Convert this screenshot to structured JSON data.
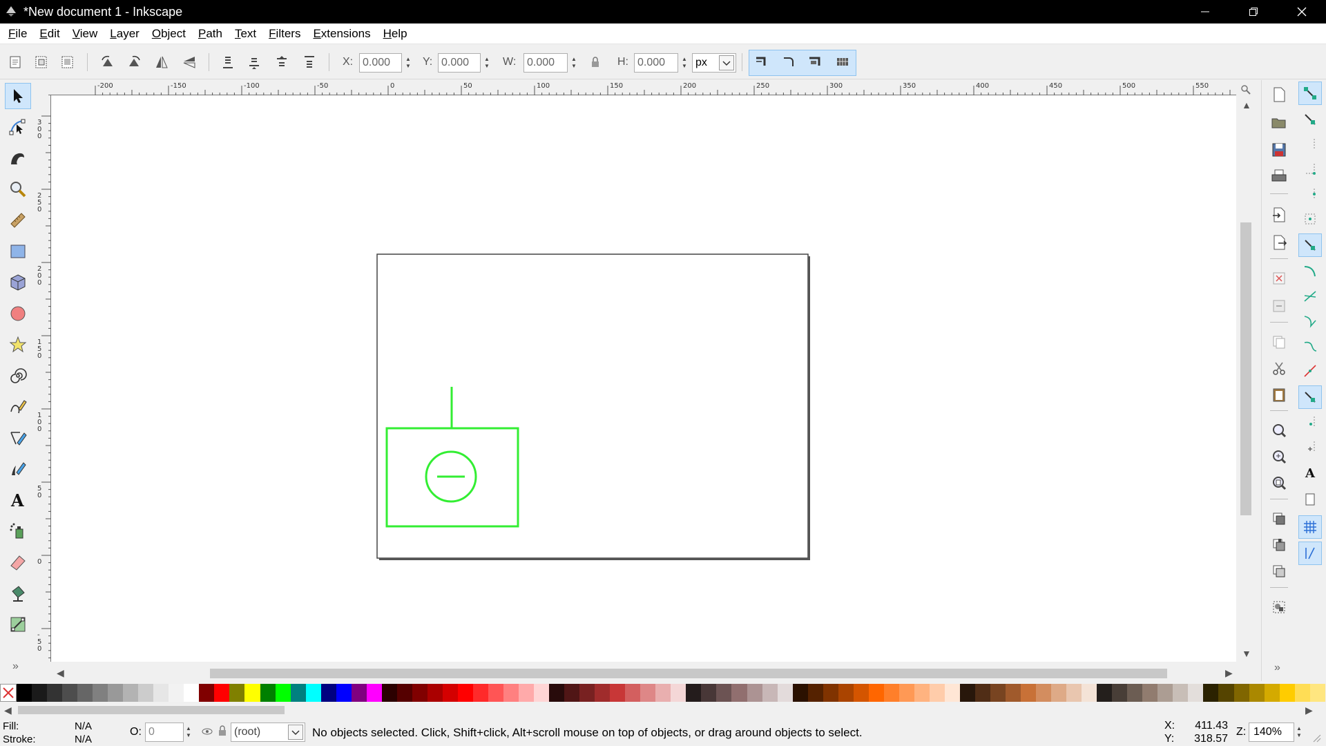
{
  "window": {
    "title": "*New document 1 - Inkscape",
    "icons": [
      "inkscape-logo-icon",
      "minimize-icon",
      "restore-icon",
      "close-icon"
    ]
  },
  "menu": [
    "File",
    "Edit",
    "View",
    "Layer",
    "Object",
    "Path",
    "Text",
    "Filters",
    "Extensions",
    "Help"
  ],
  "toolbar": {
    "x_label": "X:",
    "x_value": "0.000",
    "y_label": "Y:",
    "y_value": "0.000",
    "w_label": "W:",
    "w_value": "0.000",
    "h_label": "H:",
    "h_value": "0.000",
    "unit": "px",
    "spin_up": "▲",
    "spin_down": "▼"
  },
  "tools": [
    "selector-tool",
    "node-tool",
    "tweak-tool",
    "zoom-tool",
    "measure-tool",
    "rectangle-tool",
    "3d-box-tool",
    "ellipse-tool",
    "star-tool",
    "spiral-tool",
    "pencil-tool",
    "pen-tool",
    "calligraphy-tool",
    "text-tool",
    "spray-tool",
    "eraser-tool",
    "paint-bucket-tool",
    "gradient-tool"
  ],
  "active_tool": "selector-tool",
  "more_glyph": "»",
  "ruler": {
    "h_labels": [
      "-200",
      "-150",
      "-100",
      "-50",
      "0",
      "50",
      "100",
      "150",
      "200",
      "250",
      "300",
      "350",
      "400",
      "450",
      "500",
      "550"
    ],
    "v_labels": [
      "300",
      "250",
      "200",
      "150",
      "100",
      "50",
      "0",
      "-50"
    ]
  },
  "scroll_arrows": {
    "up": "▲",
    "down": "▼",
    "left": "◀",
    "right": "▶"
  },
  "drawing": {
    "stroke_color": "#33ee33",
    "page_border_color": "#333333"
  },
  "commands": [
    "new-document-icon",
    "open-icon",
    "save-icon",
    "print-icon",
    "import-icon",
    "export-icon",
    "undo-icon",
    "redo-icon",
    "copy-icon",
    "cut-icon",
    "paste-icon",
    "zoom-selection-icon",
    "zoom-drawing-icon",
    "zoom-page-icon",
    "duplicate-icon",
    "clone-icon",
    "unlink-clone-icon",
    "group-icon"
  ],
  "snap_controls": [
    "snap-toggle-icon",
    "snap-bbox-icon",
    "snap-bbox-edge-icon",
    "snap-bbox-corner-icon",
    "snap-bbox-midpoint-icon",
    "snap-bbox-center-icon",
    "snap-nodes-icon",
    "snap-path-icon",
    "snap-path-intersection-icon",
    "snap-cusp-icon",
    "snap-smooth-icon",
    "snap-line-midpoint-icon",
    "snap-others-icon",
    "snap-center-icon",
    "snap-rotation-center-icon",
    "snap-text-baseline-icon",
    "snap-page-border-icon",
    "snap-grid-icon",
    "snap-guide-icon"
  ],
  "palette": {
    "colors": [
      "#000000",
      "#1a1a1a",
      "#333333",
      "#4d4d4d",
      "#666666",
      "#808080",
      "#999999",
      "#b3b3b3",
      "#cccccc",
      "#e6e6e6",
      "#f2f2f2",
      "#ffffff",
      "#800000",
      "#ff0000",
      "#808000",
      "#ffff00",
      "#008000",
      "#00ff00",
      "#008080",
      "#00ffff",
      "#000080",
      "#0000ff",
      "#800080",
      "#ff00ff",
      "#2b0000",
      "#550000",
      "#800000",
      "#aa0000",
      "#d40000",
      "#ff0000",
      "#ff2a2a",
      "#ff5555",
      "#ff8080",
      "#ffaaaa",
      "#ffd5d5",
      "#280b0b",
      "#501616",
      "#782121",
      "#a02c2c",
      "#c83737",
      "#d35f5f",
      "#de8787",
      "#e9afaf",
      "#f4d7d7",
      "#241c1c",
      "#483737",
      "#6c5353",
      "#916f6f",
      "#ac9393",
      "#c8b7b7",
      "#e3dbdb",
      "#2b1100",
      "#552200",
      "#803300",
      "#aa4400",
      "#d45500",
      "#ff6600",
      "#ff7f2a",
      "#ff9955",
      "#ffb380",
      "#ffccaa",
      "#ffe6d5",
      "#28170b",
      "#502d16",
      "#784421",
      "#a05a2c",
      "#c87137",
      "#d38d5f",
      "#deaa87",
      "#e9c6af",
      "#f4e3d7",
      "#241f1c",
      "#483e37",
      "#6c5d53",
      "#917c6f",
      "#ac9d93",
      "#c8beb7",
      "#e3dedb",
      "#2b2200",
      "#554400",
      "#806600",
      "#aa8800",
      "#d4aa00",
      "#ffcc00",
      "#ffdd55",
      "#ffe680"
    ]
  },
  "status": {
    "fill_label": "Fill:",
    "fill_value": "N/A",
    "stroke_label": "Stroke:",
    "stroke_value": "N/A",
    "opacity_label": "O:",
    "opacity_value": "0",
    "layer": "(root)",
    "message": "No objects selected. Click, Shift+click, Alt+scroll mouse on top of objects, or drag around objects to select.",
    "x_label": "X:",
    "x_value": "411.43",
    "y_label": "Y:",
    "y_value": "318.57",
    "zoom_label": "Z:",
    "zoom_value": "140%"
  }
}
